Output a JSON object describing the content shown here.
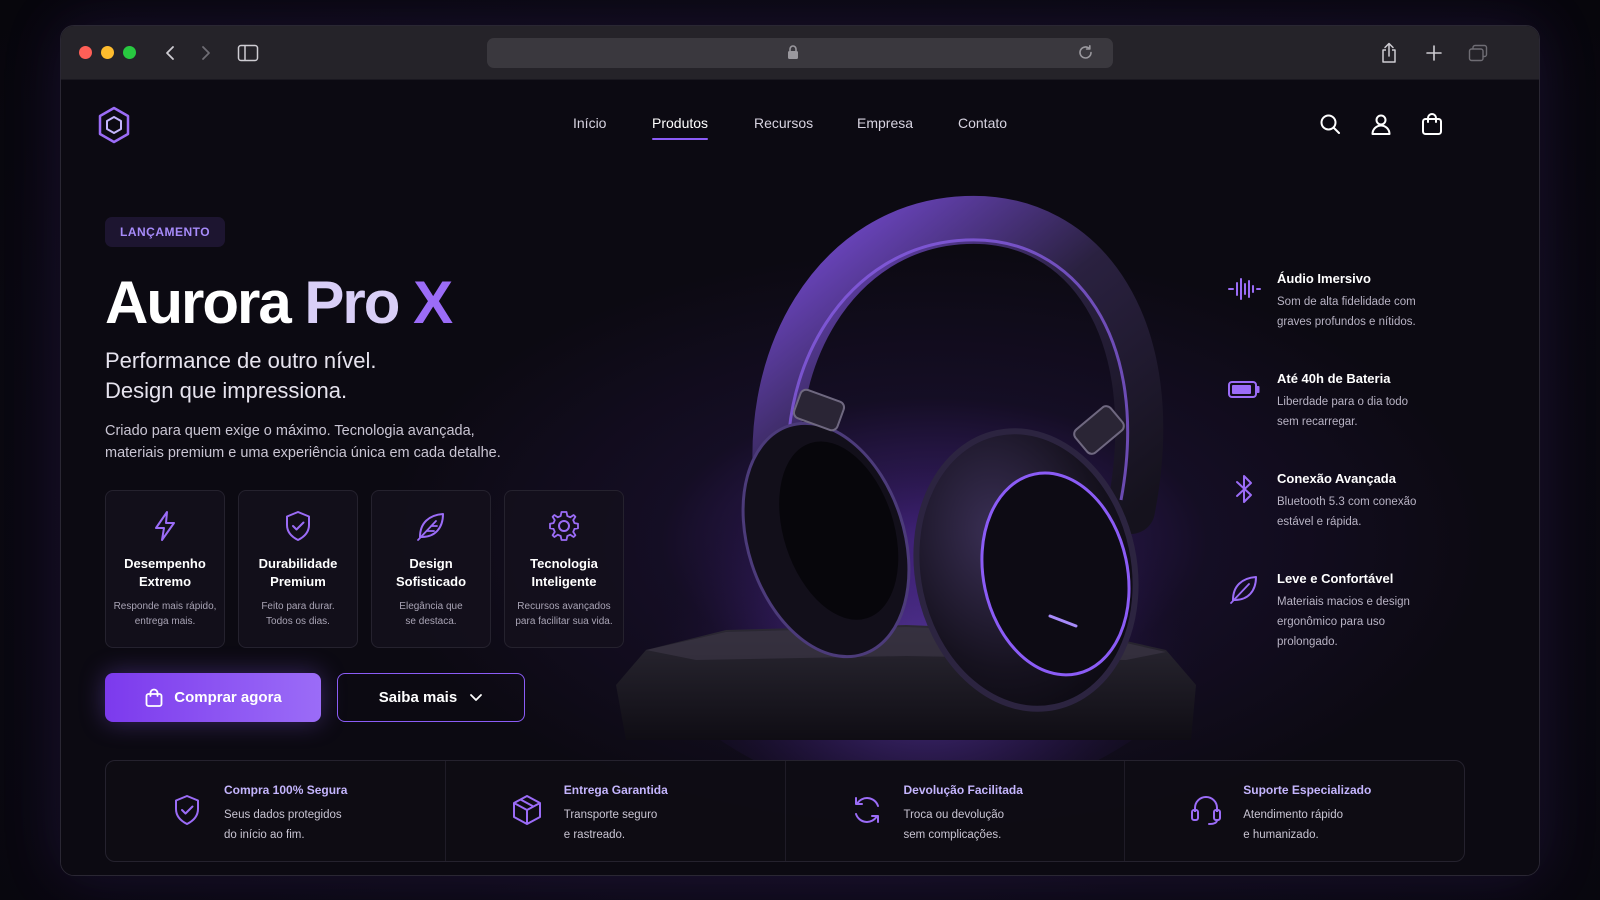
{
  "browser": {
    "traffic_colors": [
      "#ff5f57",
      "#febc2e",
      "#28c840"
    ],
    "icons": [
      "back-icon",
      "forward-icon",
      "sidebar-icon",
      "lock-icon",
      "reload-icon",
      "share-icon",
      "new-tab-icon",
      "tab-overview-icon"
    ]
  },
  "nav": {
    "items": [
      "Início",
      "Produtos",
      "Recursos",
      "Empresa",
      "Contato"
    ],
    "active": "Produtos",
    "icons": [
      "search-icon",
      "user-icon",
      "bag-icon"
    ]
  },
  "hero": {
    "badge": "LANÇAMENTO",
    "title_main": "Aurora",
    "title_pro": "Pro",
    "title_x": "X",
    "subtitle_line1": "Performance de outro nível.",
    "subtitle_line2": "Design que impressiona.",
    "desc_line1": "Criado para quem exige o máximo. Tecnologia avançada,",
    "desc_line2": "materiais premium e uma experiência única em cada detalhe."
  },
  "cards": [
    {
      "icon": "bolt-icon",
      "title1": "Desempenho",
      "title2": "Extremo",
      "desc1": "Responde mais rápido,",
      "desc2": "entrega mais."
    },
    {
      "icon": "shield-check-icon",
      "title1": "Durabilidade",
      "title2": "Premium",
      "desc1": "Feito para durar.",
      "desc2": "Todos os dias."
    },
    {
      "icon": "leaf-icon",
      "title1": "Design",
      "title2": "Sofisticado",
      "desc1": "Elegância que",
      "desc2": "se destaca."
    },
    {
      "icon": "gear-icon",
      "title1": "Tecnologia",
      "title2": "Inteligente",
      "desc1": "Recursos avançados",
      "desc2": "para facilitar sua vida."
    }
  ],
  "buttons": {
    "buy": "Comprar agora",
    "more": "Saiba mais"
  },
  "features": [
    {
      "icon": "waveform-icon",
      "title": "Áudio Imersivo",
      "desc1": "Som de alta fidelidade com",
      "desc2": "graves profundos e nítidos.",
      "desc3": ""
    },
    {
      "icon": "battery-icon",
      "title": "Até 40h de Bateria",
      "desc1": "Liberdade para o dia todo",
      "desc2": "sem recarregar.",
      "desc3": ""
    },
    {
      "icon": "bluetooth-icon",
      "title": "Conexão Avançada",
      "desc1": "Bluetooth 5.3 com conexão",
      "desc2": "estável e rápida.",
      "desc3": ""
    },
    {
      "icon": "feather-icon",
      "title": "Leve e Confortável",
      "desc1": "Materiais macios e design",
      "desc2": "ergonômico para uso",
      "desc3": "prolongado."
    }
  ],
  "guarantees": [
    {
      "icon": "shield-check-icon",
      "title": "Compra 100% Segura",
      "desc1": "Seus dados protegidos",
      "desc2": "do início ao fim."
    },
    {
      "icon": "box-icon",
      "title": "Entrega Garantida",
      "desc1": "Transporte seguro",
      "desc2": "e rastreado."
    },
    {
      "icon": "refresh-icon",
      "title": "Devolução Facilitada",
      "desc1": "Troca ou devolução",
      "desc2": "sem complicações."
    },
    {
      "icon": "headset-icon",
      "title": "Suporte Especializado",
      "desc1": "Atendimento rápido",
      "desc2": "e humanizado."
    }
  ],
  "colors": {
    "accent": "#8b5cf6",
    "accent_light": "#a78bfa",
    "background": "#0c0a12"
  }
}
